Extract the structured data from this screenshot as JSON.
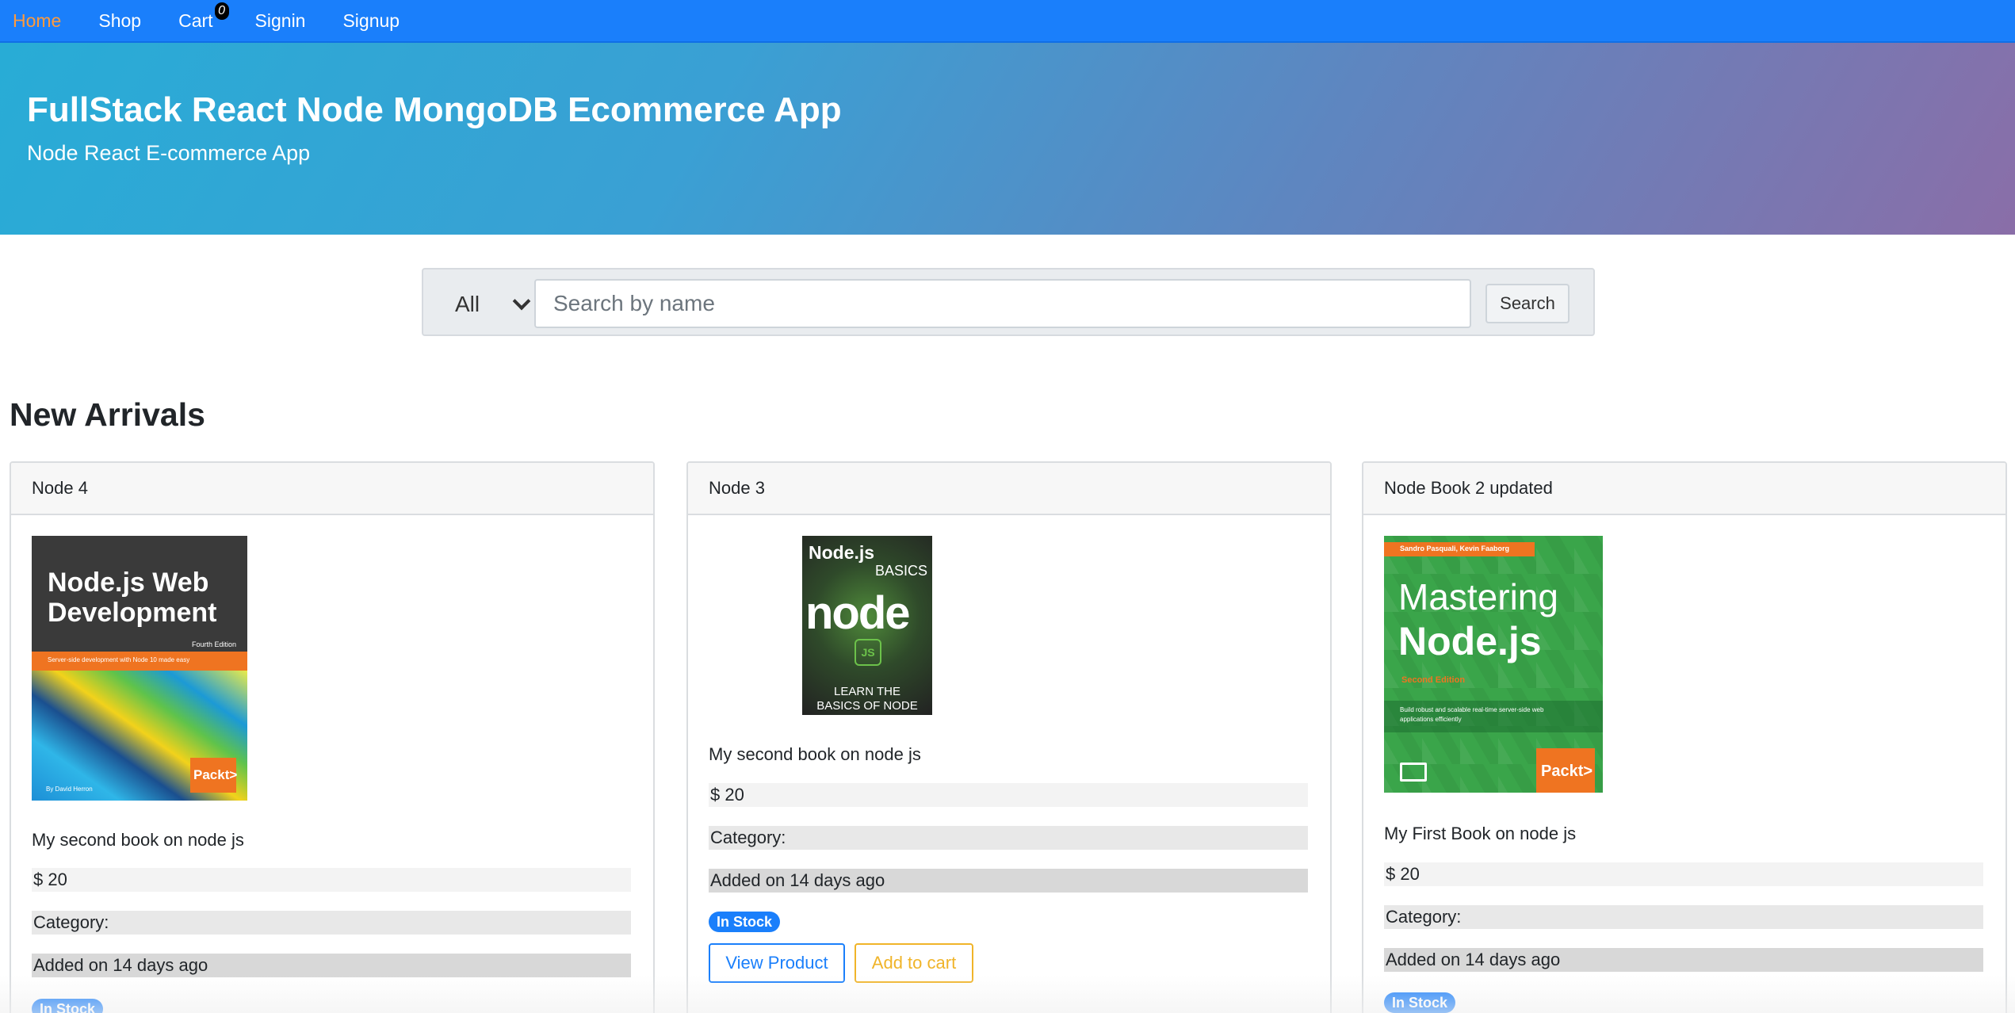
{
  "nav": {
    "items": [
      {
        "label": "Home",
        "active": true
      },
      {
        "label": "Shop"
      },
      {
        "label": "Cart"
      },
      {
        "label": "Signin"
      },
      {
        "label": "Signup"
      }
    ],
    "cart_count": "0"
  },
  "jumbotron": {
    "title": "FullStack React Node MongoDB Ecommerce App",
    "subtitle": "Node React E-commerce App"
  },
  "search": {
    "category_selected": "All",
    "placeholder": "Search by name",
    "value": "",
    "button_label": "Search"
  },
  "section": {
    "title": "New Arrivals"
  },
  "products": [
    {
      "name": "Node 4",
      "description": "My second book on node js",
      "price": "$ 20",
      "category": "Category:",
      "added": "Added on 14 days ago",
      "stock": "In Stock",
      "cover": {
        "title_line1": "Node.js Web",
        "title_line2": "Development",
        "edition": "Fourth Edition",
        "tagline": "Server-side development with Node 10 made easy",
        "author": "By David Herron",
        "publisher": "Packt>"
      }
    },
    {
      "name": "Node 3",
      "description": "My second book on node js",
      "price": "$ 20",
      "category": "Category:",
      "added": "Added on 14 days ago",
      "stock": "In Stock",
      "view_label": "View Product",
      "cart_label": "Add to cart",
      "cover": {
        "title_line1": "Node.js",
        "title_line2": "BASICS",
        "logo": "node",
        "logo_sub": "JS",
        "footer_line1": "LEARN THE",
        "footer_line2": "BASICS OF NODE"
      }
    },
    {
      "name": "Node Book 2 updated",
      "description": "My First Book on node js",
      "price": "$ 20",
      "category": "Category:",
      "added": "Added on 14 days ago",
      "stock": "In Stock",
      "cover": {
        "authors": "Sandro Pasquali, Kevin Faaborg",
        "title_line1": "Mastering",
        "title_line2": "Node.js",
        "edition": "Second Edition",
        "tagline": "Build robust and scalable real-time server-side web applications efficiently",
        "publisher": "Packt>"
      }
    }
  ],
  "colors": {
    "navbar": "#1a7ffb",
    "nav_active": "#ff9a3c",
    "primary": "#1a7ffb",
    "warning": "#f0b429"
  }
}
